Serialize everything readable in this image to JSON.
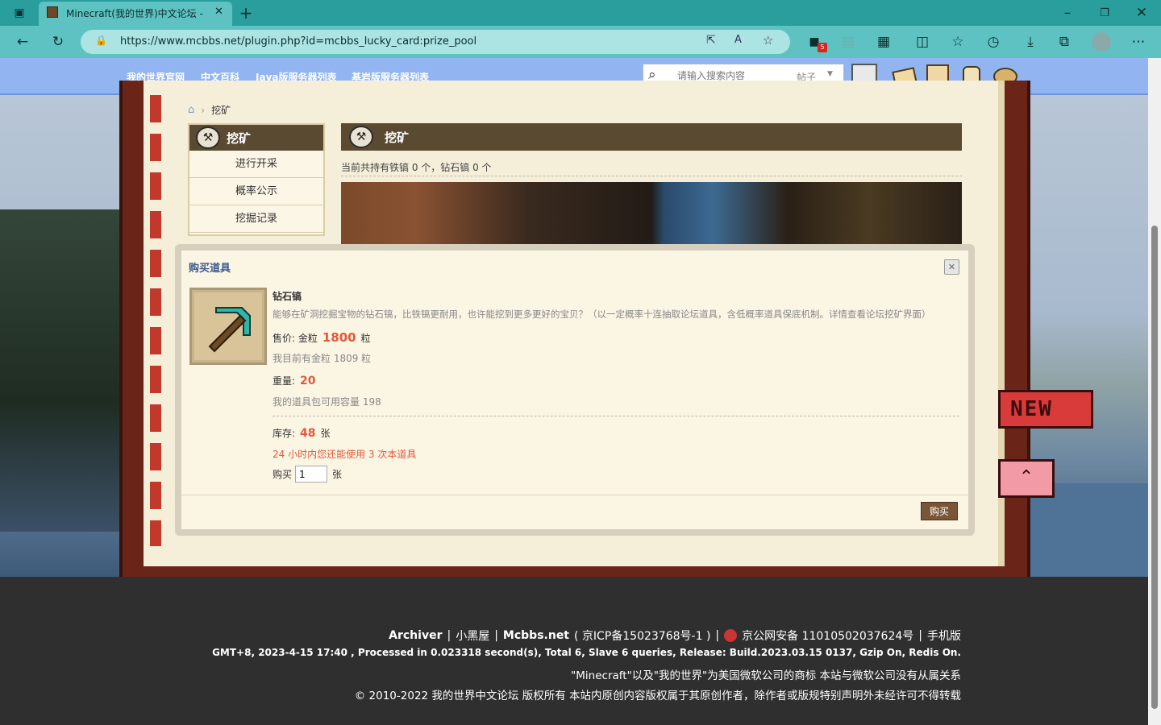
{
  "browser": {
    "tab_title": "Minecraft(我的世界)中文论坛 -",
    "url": "https://www.mcbbs.net/plugin.php?id=mcbbs_lucky_card:prize_pool",
    "ext_badge": "5"
  },
  "site_nav": {
    "links": [
      "我的世界官网",
      "中文百科",
      "Java版服务器列表",
      "基岩版服务器列表"
    ],
    "search_placeholder": "请输入搜索内容",
    "search_type": "帖子"
  },
  "breadcrumb": {
    "current": "挖矿"
  },
  "sidebar": {
    "title": "挖矿",
    "items": [
      "进行开采",
      "概率公示",
      "挖掘记录"
    ]
  },
  "main": {
    "title": "挖矿",
    "status": "当前共持有铁镐 0 个，钻石镐 0 个"
  },
  "dialog": {
    "title": "购买道具",
    "item_name": "钻石镐",
    "item_desc": "能够在矿洞挖掘宝物的钻石镐，比铁镐更耐用，也许能挖到更多更好的宝贝？（以一定概率十连抽取论坛道具，含低概率道具保底机制。详情查看论坛挖矿界面）",
    "price_label": "售价: 金粒",
    "price_value": "1800",
    "price_unit": "粒",
    "have_text": "我目前有金粒 1809 粒",
    "weight_label": "重量:",
    "weight_value": "20",
    "capacity_text": "我的道具包可用容量 198",
    "stock_label": "库存:",
    "stock_value": "48",
    "stock_unit": "张",
    "usage_text": "24 小时内您还能使用 3 次本道具",
    "buy_label": "购买",
    "buy_qty": "1",
    "buy_unit": "张",
    "buy_button": "购买",
    "close_symbol": "✕"
  },
  "floating": {
    "new_label": "NEW"
  },
  "footer": {
    "line1_a": "Archiver",
    "line1_b": "小黑屋",
    "line1_c": "Mcbbs.net",
    "line1_d": "( 京ICP备15023768号-1 )",
    "line1_e": "京公网安备 11010502037624号",
    "line1_f": "手机版",
    "line2": "GMT+8, 2023-4-15 17:40 , Processed in 0.023318 second(s), Total 6, Slave 6 queries, Release: Build.2023.03.15 0137, Gzip On, Redis On.",
    "line3": "\"Minecraft\"以及\"我的世界\"为美国微软公司的商标 本站与微软公司没有从属关系",
    "line4": "© 2010-2022 我的世界中文论坛 版权所有 本站内原创内容版权属于其原创作者，除作者或版规特别声明外未经许可不得转载"
  },
  "colors": {
    "accent_orange": "#e2593a",
    "header_brown": "#5a4a32",
    "nav_blue": "#92b4f0"
  }
}
